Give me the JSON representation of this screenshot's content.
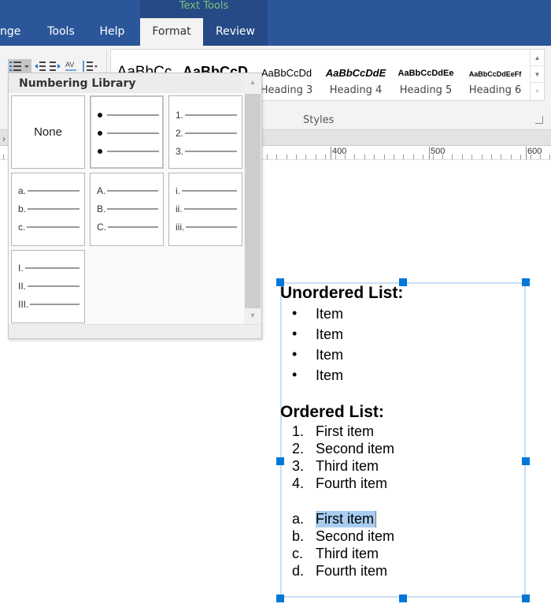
{
  "tabs": {
    "context_group": "Text Tools",
    "items": [
      {
        "label": "nge",
        "active": false
      },
      {
        "label": "Tools",
        "active": false
      },
      {
        "label": "Help",
        "active": false
      },
      {
        "label": "Format",
        "active": true
      },
      {
        "label": "Review",
        "active": false
      }
    ]
  },
  "ribbon": {
    "paragraph_tools": [
      "bullets-list-icon",
      "dropdown-arrow-icon",
      "decrease-indent-icon",
      "increase-indent-icon",
      "character-spacing-icon",
      "line-spacing-icon"
    ],
    "styles": [
      {
        "sample": "AaBbCc",
        "name": ""
      },
      {
        "sample": "AaBbCcD",
        "name": ""
      },
      {
        "sample": "AaBbCcDd",
        "name": "Heading 3"
      },
      {
        "sample": "AaBbCcDdE",
        "name": "Heading 4"
      },
      {
        "sample": "AaBbCcDdEe",
        "name": "Heading 5"
      },
      {
        "sample": "AaBbCcDdEeFf",
        "name": "Heading 6"
      }
    ],
    "styles_group_label": "Styles"
  },
  "ruler": {
    "labels": [
      "400",
      "500",
      "600"
    ]
  },
  "numbering_library": {
    "title": "Numbering Library",
    "none_label": "None",
    "options": [
      {
        "name": "none"
      },
      {
        "name": "bullet",
        "markers": [
          "•",
          "•",
          "•"
        ]
      },
      {
        "name": "decimal",
        "markers": [
          "1.",
          "2.",
          "3."
        ]
      },
      {
        "name": "lower-alpha",
        "markers": [
          "a.",
          "b.",
          "c."
        ]
      },
      {
        "name": "upper-alpha",
        "markers": [
          "A.",
          "B.",
          "C."
        ]
      },
      {
        "name": "lower-roman",
        "markers": [
          "i.",
          "ii.",
          "iii."
        ]
      },
      {
        "name": "upper-roman",
        "markers": [
          "I.",
          "II.",
          "III."
        ]
      }
    ]
  },
  "document": {
    "unordered_heading": "Unordered List:",
    "unordered_items": [
      "Item",
      "Item",
      "Item",
      "Item"
    ],
    "bullet": "•",
    "ordered_heading": "Ordered List:",
    "ordered_items": [
      {
        "marker": "1.",
        "text": "First item"
      },
      {
        "marker": "2.",
        "text": "Second item"
      },
      {
        "marker": "3.",
        "text": "Third item"
      },
      {
        "marker": "4.",
        "text": "Fourth item"
      }
    ],
    "alpha_items": [
      {
        "marker": "a.",
        "text": "First item",
        "selected": true
      },
      {
        "marker": "b.",
        "text": "Second item"
      },
      {
        "marker": "c.",
        "text": "Third item"
      },
      {
        "marker": "d.",
        "text": "Fourth item"
      }
    ]
  },
  "colors": {
    "tabbar": "#2b579a",
    "context_tab": "#254a86",
    "context_label": "#7cc47f",
    "handle": "#0078d7",
    "selection": "#a8cdf0"
  }
}
